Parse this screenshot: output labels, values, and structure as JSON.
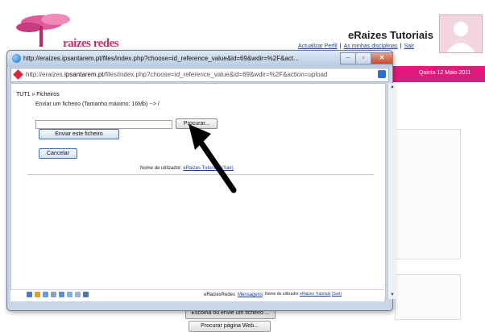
{
  "background": {
    "logo_text": "raizes redes",
    "site_title": "eRaizes Tutoriais",
    "top_links": [
      "Actualizar Perfil",
      "As minhas disciplinas",
      "Sair"
    ],
    "date": "Quinta 12 Maio 2011",
    "buttons": [
      "Escolha ou envie um ficheiro ...",
      "Procurar página Web..."
    ]
  },
  "window": {
    "title": "http://eraizes.ipsantarem.pt/files/index.php?choose=id_reference_value&id=69&wdir=%2F&act...",
    "address_prefix": "http://eraizes.",
    "address_host": "ipsantarem.pt",
    "address_rest": "/files/index.php?choose=id_reference_value&id=69&wdir=%2F&action=upload",
    "controls": [
      "–",
      "▫",
      "✕"
    ]
  },
  "content": {
    "breadcrumb": "TUT1 » Ficheiros",
    "upload_info": "Enviar um ficheiro (Tamanho máximo: 16Mb) --> /",
    "browse_label": "Procurar...",
    "send_label": "Enviar este ficheiro",
    "cancel_label": "Cancelar",
    "user_prefix": "Nome de utilizador:",
    "user_name": "eRaizes Tutoriais",
    "user_exit": "(Sair)"
  },
  "footer": {
    "site": "eRaizesRedes",
    "messages": "Mensagens",
    "user_prefix": "Nome de utilizador",
    "user_name": "eRaizes Tutoriais",
    "user_exit": "(Sair)",
    "icon_names": [
      "print-icon",
      "user-icon",
      "mail-icon",
      "list-icon",
      "chat-icon",
      "chat2-icon",
      "settings-icon",
      "search-icon"
    ]
  },
  "colors": {
    "accent": "#e2197c",
    "link": "#1b3f8f"
  }
}
